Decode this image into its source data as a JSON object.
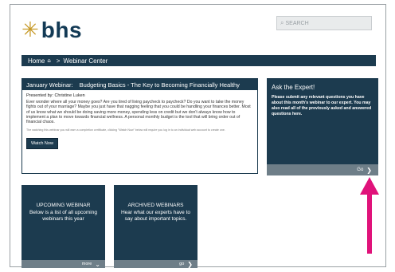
{
  "brand": {
    "logo_mark": "✳",
    "logo_text": "bhs",
    "logo_color": "#c79a28",
    "text_color": "#133a55"
  },
  "search": {
    "placeholder": "SEARCH",
    "icon": "search-icon"
  },
  "breadcrumb": {
    "home": "Home",
    "home_icon": "home-icon",
    "separator": ">",
    "current": "Webinar Center"
  },
  "webinar": {
    "month_label": "January Webinar:",
    "topic": "Budgeting Basics - The Key to Becoming Financially Healthy",
    "presented_by": "Presented by: Christine Luken",
    "description": "Ever wonder where all your money goes? Are you tired of living paycheck to paycheck? Do you want to take the money fights out of your marriage? Maybe you just have that nagging feeling that you could be handling your finances better. Most of us know what we should be doing saving more money, spending less on credit but we don't always know how to implement a plan to move towards financial wellness. A personal monthly budget is the tool that will bring order out of financial chaos.",
    "fine_print": "The watching this webinar you will earn a completion certificate, clicking \"Watch Now\" below will require you log in to an individual web account to create one.",
    "watch_label": "Watch Now"
  },
  "ask": {
    "title": "Ask the Expert!",
    "text": "Please submit any relevant questions you have about this month's webinar to our expert. You may also read all of the previously asked and answered questions here.",
    "go_label": "Go"
  },
  "tiles": [
    {
      "title": "UPCOMING WEBINAR",
      "desc": "Below is a list of all upcoming webinars this year",
      "foot": "more"
    },
    {
      "title": "ARCHIVED WEBINARS",
      "desc": "Hear what our experts have to say about important topics.",
      "foot": "go"
    }
  ],
  "colors": {
    "navy": "#1c3b4f",
    "footer_gray": "#6e7e88",
    "arrow": "#e0127a"
  },
  "icons": {
    "chevron": "chevron-right-icon",
    "arrow": "arrow-up-icon"
  }
}
